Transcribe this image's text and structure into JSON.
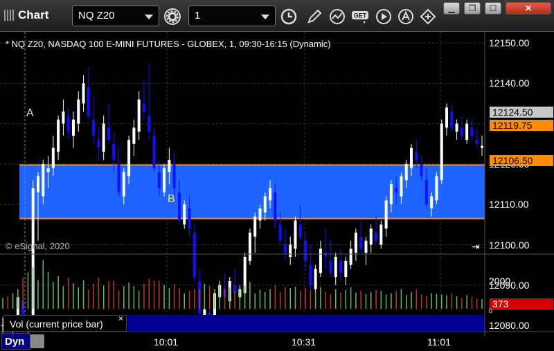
{
  "titlebar": {
    "title": "Chart",
    "symbol": "NQ Z20",
    "interval": "1"
  },
  "chart_header": "* NQ Z20, NASDAQ 100 E-MINI FUTURES - GLOBEX, 1, 09:30-16:15 (Dynamic)",
  "copyright": "© eSignal, 2020",
  "annotations": {
    "a": "A",
    "b": "B"
  },
  "price_labels": {
    "last": "12124.50",
    "upper_line": "12119.75",
    "lower_line": "12106.50"
  },
  "colors": {
    "band_fill": "#1e64ff",
    "band_line": "#ff8c00",
    "up_candle": "#ffffff",
    "down_candle": "#1010ff",
    "vol_up": "#5bbf5b",
    "vol_down": "#c03a1a",
    "vol_badge": "#d40000"
  },
  "volume": {
    "title": "Vol (current price bar)",
    "close_glyph": "×",
    "current_value": "373",
    "axis_label": "2000",
    "axis_zero": "0"
  },
  "footer": {
    "mode": "Dyn"
  },
  "chart_data": {
    "type": "candlestick",
    "yaxis": {
      "ticks": [
        "12150.00",
        "12140.00",
        "12130.00",
        "12120.00",
        "12110.00",
        "12100.00",
        "12090.00",
        "12080.00"
      ],
      "min": 12075,
      "max": 12152
    },
    "xaxis": {
      "ticks": [
        "10:01",
        "10:31",
        "11:01"
      ]
    },
    "band": {
      "upper": 12119.75,
      "lower": 12106.5
    },
    "ohlc": [
      [
        12080,
        12082,
        12078,
        12080
      ],
      [
        12081,
        12083,
        12078,
        12079
      ],
      [
        12080,
        12082,
        12078,
        12081
      ],
      [
        12081,
        12088,
        12080,
        12087
      ],
      [
        12086,
        12087,
        12078,
        12079
      ],
      [
        12080,
        12081,
        12078,
        12080
      ],
      [
        12080,
        12116,
        12079,
        12114
      ],
      [
        12113,
        12118,
        12101,
        12117
      ],
      [
        12112,
        12121,
        12110,
        12120
      ],
      [
        12118,
        12122,
        12114,
        12119
      ],
      [
        12119,
        12127,
        12117,
        12124
      ],
      [
        12123,
        12132,
        12121,
        12131
      ],
      [
        12130,
        12136,
        12127,
        12133
      ],
      [
        12132,
        12134,
        12126,
        12128
      ],
      [
        12127,
        12133,
        12124,
        12131
      ],
      [
        12130,
        12138,
        12128,
        12136
      ],
      [
        12135,
        12142,
        12133,
        12140
      ],
      [
        12139,
        12144,
        12131,
        12132
      ],
      [
        12131,
        12137,
        12125,
        12127
      ],
      [
        12126,
        12129,
        12121,
        12124
      ],
      [
        12123,
        12132,
        12121,
        12130
      ],
      [
        12129,
        12135,
        12125,
        12126
      ],
      [
        12125,
        12128,
        12118,
        12121
      ],
      [
        12120,
        12124,
        12112,
        12113
      ],
      [
        12112,
        12119,
        12110,
        12118
      ],
      [
        12117,
        12127,
        12115,
        12126
      ],
      [
        12125,
        12131,
        12122,
        12129
      ],
      [
        12128,
        12138,
        12126,
        12136
      ],
      [
        12135,
        12141,
        12131,
        12133
      ],
      [
        12132,
        12145,
        12126,
        12128
      ],
      [
        12127,
        12129,
        12118,
        12119
      ],
      [
        12118,
        12121,
        12112,
        12114
      ],
      [
        12113,
        12120,
        12112,
        12119
      ],
      [
        12118,
        12124,
        12115,
        12121
      ],
      [
        12120,
        12123,
        12112,
        12114
      ],
      [
        12113,
        12116,
        12105,
        12106
      ],
      [
        12105,
        12111,
        12104,
        12110
      ],
      [
        12109,
        12112,
        12102,
        12104
      ],
      [
        12103,
        12105,
        12091,
        12092
      ],
      [
        12091,
        12094,
        12082,
        12083
      ],
      [
        12082,
        12085,
        12080,
        12084
      ],
      [
        12083,
        12087,
        12079,
        12081
      ],
      [
        12080,
        12089,
        12079,
        12088
      ],
      [
        12087,
        12091,
        12085,
        12090
      ],
      [
        12089,
        12093,
        12086,
        12087
      ],
      [
        12086,
        12092,
        12085,
        12091
      ],
      [
        12090,
        12094,
        12087,
        12088
      ],
      [
        12087,
        12090,
        12084,
        12089
      ],
      [
        12088,
        12098,
        12087,
        12097
      ],
      [
        12096,
        12104,
        12095,
        12103
      ],
      [
        12102,
        12108,
        12098,
        12107
      ],
      [
        12106,
        12110,
        12104,
        12109
      ],
      [
        12108,
        12113,
        12106,
        12112
      ],
      [
        12111,
        12116,
        12109,
        12114
      ],
      [
        12113,
        12115,
        12104,
        12106
      ],
      [
        12105,
        12108,
        12100,
        12101
      ],
      [
        12100,
        12104,
        12096,
        12098
      ],
      [
        12097,
        12102,
        12095,
        12100
      ],
      [
        12099,
        12107,
        12097,
        12106
      ],
      [
        12105,
        12110,
        12101,
        12102
      ],
      [
        12101,
        12103,
        12094,
        12096
      ],
      [
        12095,
        12100,
        12088,
        12090
      ],
      [
        12089,
        12095,
        12087,
        12094
      ],
      [
        12093,
        12101,
        12092,
        12099
      ],
      [
        12098,
        12104,
        12094,
        12097
      ],
      [
        12096,
        12101,
        12092,
        12093
      ],
      [
        12092,
        12098,
        12090,
        12097
      ],
      [
        12096,
        12099,
        12091,
        12093
      ],
      [
        12092,
        12097,
        12090,
        12096
      ],
      [
        12095,
        12101,
        12094,
        12099
      ],
      [
        12098,
        12104,
        12096,
        12103
      ],
      [
        12102,
        12106,
        12098,
        12099
      ],
      [
        12098,
        12102,
        12095,
        12101
      ],
      [
        12100,
        12105,
        12098,
        12104
      ],
      [
        12103,
        12107,
        12100,
        12101
      ],
      [
        12100,
        12106,
        12099,
        12105
      ],
      [
        12104,
        12112,
        12102,
        12111
      ],
      [
        12110,
        12116,
        12108,
        12115
      ],
      [
        12114,
        12117,
        12110,
        12113
      ],
      [
        12112,
        12118,
        12110,
        12117
      ],
      [
        12116,
        12121,
        12114,
        12120
      ],
      [
        12119,
        12125,
        12117,
        12124
      ],
      [
        12123,
        12126,
        12119,
        12121
      ],
      [
        12120,
        12122,
        12116,
        12117
      ],
      [
        12116,
        12119,
        12109,
        12110
      ],
      [
        12109,
        12113,
        12107,
        12112
      ],
      [
        12111,
        12118,
        12110,
        12117
      ],
      [
        12116,
        12131,
        12115,
        12130
      ],
      [
        12129,
        12135,
        12127,
        12134
      ],
      [
        12133,
        12135,
        12128,
        12129
      ],
      [
        12128,
        12131,
        12126,
        12130
      ],
      [
        12129,
        12132,
        12126,
        12127
      ],
      [
        12126,
        12131,
        12125,
        12130
      ],
      [
        12129,
        12131,
        12126,
        12127
      ],
      [
        12126,
        12129,
        12124,
        12125
      ],
      [
        12124,
        12127,
        12122,
        12124.5
      ]
    ],
    "volume_values": [
      180,
      210,
      260,
      330,
      520,
      610,
      700,
      480,
      820,
      620,
      450,
      550,
      380,
      520,
      430,
      360,
      480,
      320,
      420,
      520,
      390,
      460,
      470,
      300,
      380,
      440,
      380,
      300,
      420,
      500,
      480,
      470,
      400,
      350,
      410,
      350,
      260,
      300,
      340,
      330,
      420,
      380,
      320,
      390,
      340,
      360,
      300,
      340,
      390,
      450,
      260,
      320,
      280,
      330,
      390,
      280,
      360,
      350,
      370,
      300,
      350,
      310,
      280,
      360,
      290,
      250,
      330,
      270,
      320,
      360,
      270,
      300,
      250,
      280,
      320,
      300,
      240,
      260,
      300,
      330,
      230,
      280,
      320,
      240,
      210,
      260,
      250,
      240,
      230,
      260,
      210,
      180,
      230,
      200,
      170,
      160
    ]
  }
}
